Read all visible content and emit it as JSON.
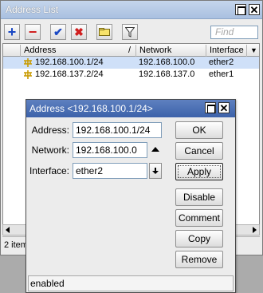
{
  "window": {
    "title": "Address List",
    "maximize_icon": "maximize-icon",
    "close_glyph": "✕",
    "find_placeholder": "Find"
  },
  "toolbar": {
    "add_glyph": "+",
    "remove_glyph": "−",
    "enable_glyph": "✔",
    "disable_glyph": "✖",
    "comment_icon": "comment-icon",
    "filter_icon": "filter-icon"
  },
  "table": {
    "columns": [
      "Address",
      "Network",
      "Interface"
    ],
    "sort_glyph": "/",
    "dropdown_glyph": "▼",
    "rows": [
      {
        "address": "192.168.100.1/24",
        "network": "192.168.100.0",
        "interface": "ether2",
        "selected": true
      },
      {
        "address": "192.168.137.2/24",
        "network": "192.168.137.0",
        "interface": "ether1",
        "selected": false
      }
    ]
  },
  "status": {
    "items_text": "2 item"
  },
  "dialog": {
    "title": "Address <192.168.100.1/24>",
    "fields": {
      "address_label": "Address:",
      "address_value": "192.168.100.1/24",
      "network_label": "Network:",
      "network_value": "192.168.100.0",
      "interface_label": "Interface:",
      "interface_value": "ether2"
    },
    "buttons": {
      "ok": "OK",
      "cancel": "Cancel",
      "apply": "Apply",
      "disable": "Disable",
      "comment": "Comment",
      "copy": "Copy",
      "remove": "Remove"
    },
    "status_text": "enabled"
  },
  "colors": {
    "selected_row": "#cfe0f8",
    "dialog_title": "#3c62aa",
    "add_icon": "#1a48c4",
    "remove_icon": "#d01e1e"
  }
}
